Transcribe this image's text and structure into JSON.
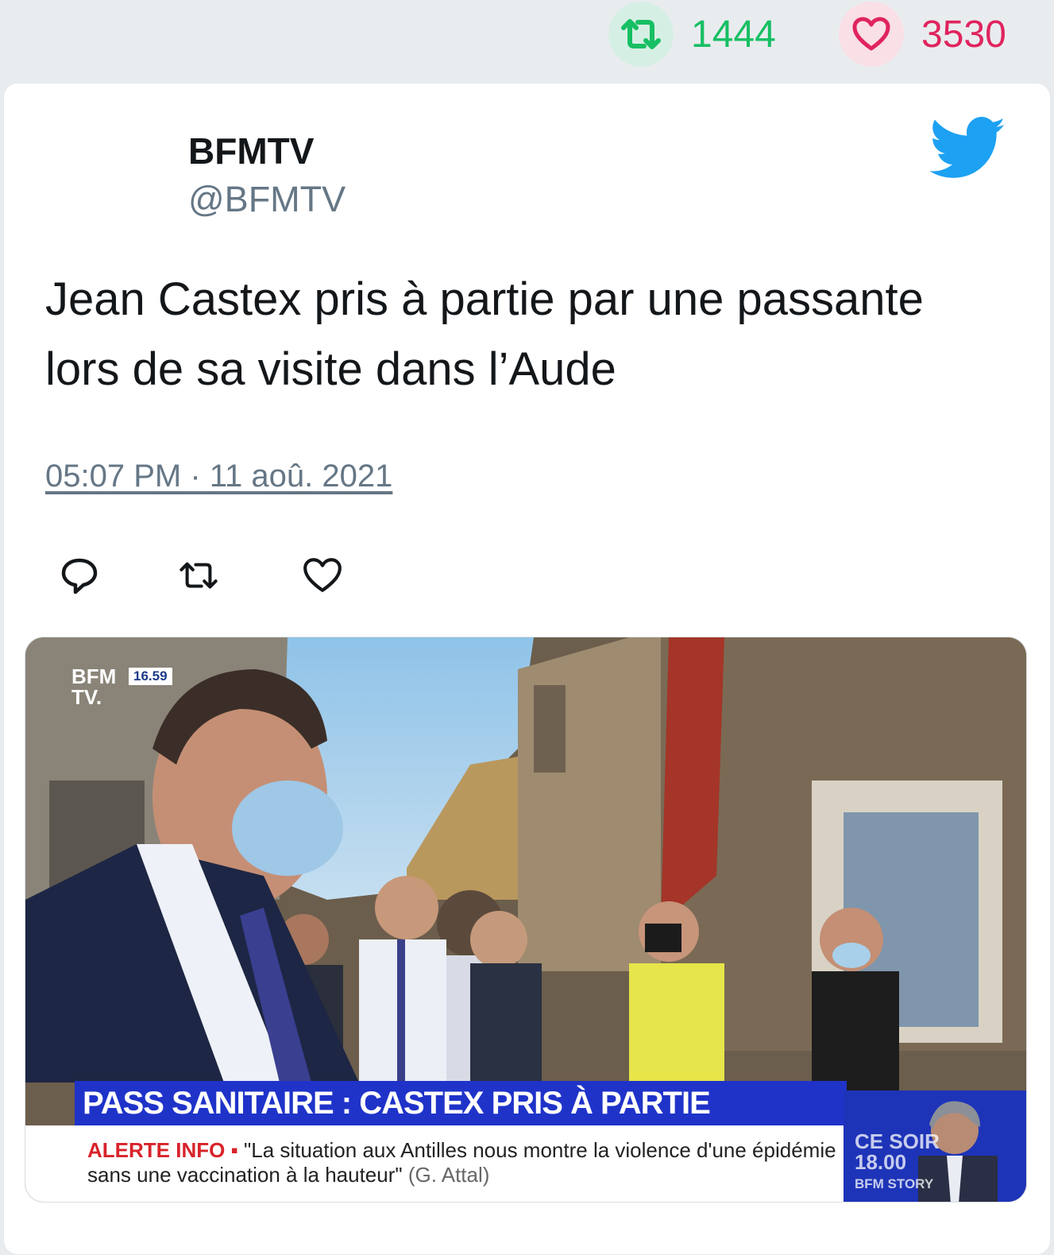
{
  "stats": {
    "retweets": "1444",
    "likes": "3530",
    "colors": {
      "retweet": "#17bf63",
      "like": "#e0245e"
    }
  },
  "tweet": {
    "author_name": "BFMTV",
    "author_handle": "@BFMTV",
    "text": "Jean Castex pris à partie par une passante lors de sa visite dans l’Aude",
    "timestamp": "05:07 PM · 11 aoû. 2021",
    "platform_icon": "twitter-bird-icon",
    "brand_color": "#1da1f2"
  },
  "actions": [
    {
      "name": "reply",
      "icon": "reply-icon"
    },
    {
      "name": "retweet",
      "icon": "retweet-icon"
    },
    {
      "name": "like",
      "icon": "heart-icon"
    }
  ],
  "media": {
    "channel_logo_line1": "BFM",
    "channel_logo_line2": "TV.",
    "broadcast_time": "16.59",
    "headline": "PASS SANITAIRE : CASTEX PRIS À PARTIE",
    "ticker_label": "ALERTE INFO ▪",
    "ticker_text": "\"La situation aux Antilles nous montre la violence d'une épidémie sans une vaccination à la hauteur\"",
    "ticker_source": "(G. Attal)",
    "promo_line1": "CE SOIR",
    "promo_line2": "18.00",
    "promo_line3": "BFM STORY"
  }
}
